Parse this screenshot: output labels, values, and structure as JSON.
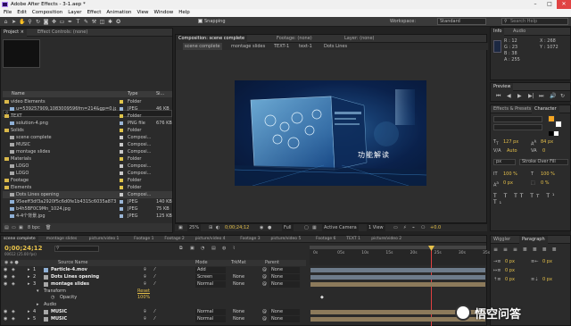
{
  "titlebar": {
    "title": "Adobe After Effects - 3-1.aep *",
    "min": "–",
    "max": "□",
    "close": "✕"
  },
  "menu": [
    "File",
    "Edit",
    "Composition",
    "Layer",
    "Effect",
    "Animation",
    "View",
    "Window",
    "Help"
  ],
  "toolbar": {
    "snapping": "Snapping",
    "workspace_label": "Workspace:",
    "workspace_value": "Standard",
    "search_placeholder": "Search Help"
  },
  "project": {
    "tabs": [
      "Project ×",
      "Effect Controls: (none)"
    ],
    "headers": {
      "name": "Name",
      "type": "Type",
      "size": "Si..."
    },
    "search_icon": "search-icon",
    "items": [
      {
        "name": "video Elements",
        "type": "Folder",
        "size": "",
        "color": "#e0c54a",
        "kind": "folder",
        "indent": 0
      },
      {
        "name": "u=539257909,1083009596fm=214&gp=0.jpg",
        "type": "JPEG",
        "size": "46 KB",
        "color": "#9bb6d6",
        "kind": "image",
        "indent": 1
      },
      {
        "name": "TEXT",
        "type": "Folder",
        "size": "",
        "color": "#e0c54a",
        "kind": "folder",
        "indent": 0
      },
      {
        "name": "solution-4.png",
        "type": "PNG file",
        "size": "676 KB",
        "color": "#9bb6d6",
        "kind": "image",
        "indent": 1
      },
      {
        "name": "Solids",
        "type": "Folder",
        "size": "",
        "color": "#e0c54a",
        "kind": "folder",
        "indent": 0
      },
      {
        "name": "scene complete",
        "type": "Composi...",
        "size": "",
        "color": "#c9c9c9",
        "kind": "comp",
        "indent": 1
      },
      {
        "name": "MUSIC",
        "type": "Composi...",
        "size": "",
        "color": "#c9c9c9",
        "kind": "comp",
        "indent": 1
      },
      {
        "name": "montage slides",
        "type": "Composi...",
        "size": "",
        "color": "#c9c9c9",
        "kind": "comp",
        "indent": 1
      },
      {
        "name": "Materials",
        "type": "Folder",
        "size": "",
        "color": "#e0c54a",
        "kind": "folder",
        "indent": 0
      },
      {
        "name": "LOGO",
        "type": "Composi...",
        "size": "",
        "color": "#c9c9c9",
        "kind": "comp",
        "indent": 1
      },
      {
        "name": "LOGO",
        "type": "Composi...",
        "size": "",
        "color": "#c9c9c9",
        "kind": "comp",
        "indent": 1
      },
      {
        "name": "Footage",
        "type": "Folder",
        "size": "",
        "color": "#e0c54a",
        "kind": "folder",
        "indent": 0
      },
      {
        "name": "Elements",
        "type": "Folder",
        "size": "",
        "color": "#e0c54a",
        "kind": "folder",
        "indent": 0
      },
      {
        "name": "Dots Lines opening",
        "type": "Composi...",
        "size": "",
        "color": "#c9c9c9",
        "kind": "comp",
        "indent": 1
      },
      {
        "name": "95eeff3df3a2920f5c6d0fe1b4315c6035a873df.jpg",
        "type": "JPEG",
        "size": "140 KB",
        "color": "#9bb6d6",
        "kind": "image",
        "indent": 1
      },
      {
        "name": "b4h5BF0C9Mn_1024.jpg",
        "type": "JPEG",
        "size": "75 KB",
        "color": "#9bb6d6",
        "kind": "image",
        "indent": 1
      },
      {
        "name": "4-4个背景.jpg",
        "type": "JPEG",
        "size": "125 KB",
        "color": "#9bb6d6",
        "kind": "image",
        "indent": 1
      }
    ],
    "footer": "8 bpc"
  },
  "viewer": {
    "tabs": [
      "Composition: scene complete",
      "Footage: (none)",
      "Layer: (none)"
    ],
    "breadcrumbs": [
      "scene complete",
      "montage slides",
      "TEXT-1",
      "text-1",
      "Dots Lines"
    ],
    "bottom": {
      "zoom": "25%",
      "time": "0;00;24;12",
      "quality": "Full",
      "camera": "Active Camera",
      "views": "1 View",
      "exposure": "+0.0"
    },
    "comp_text": "功能解读"
  },
  "timeline": {
    "tabs": [
      "scene complete",
      "montage slides",
      "picture/video 1",
      "Footage 1",
      "Footage 2",
      "picture/video 4",
      "Footage 3",
      "picture/video 5",
      "Footage 6",
      "TEXT 1",
      "picture/video 2"
    ],
    "current_time": "0;00;24;12",
    "fps": "00612 (25.00 fps)",
    "columns": {
      "source": "Source Name",
      "mode": "Mode",
      "trkmat": "TrkMat",
      "parent": "Parent"
    },
    "ruler": [
      "0s",
      "05s",
      "10s",
      "15s",
      "20s",
      "25s",
      "30s",
      "35s"
    ],
    "layers": [
      {
        "num": "1",
        "name": "Particle-4.mov",
        "mode": "Add",
        "trk": "",
        "parent": "None",
        "bar": "#6d7b8a",
        "kind": "footage"
      },
      {
        "num": "2",
        "name": "Dots Lines opening",
        "mode": "Screen",
        "trk": "None",
        "parent": "None",
        "bar": "#6d7b8a",
        "kind": "comp"
      },
      {
        "num": "3",
        "name": "montage slides",
        "mode": "Normal",
        "trk": "None",
        "parent": "None",
        "bar": "#8c7a5b",
        "kind": "comp"
      }
    ],
    "transform": {
      "label": "Transform",
      "reset": "Reset"
    },
    "opacity": {
      "label": "Opacity",
      "value": "100%"
    },
    "audio": {
      "label": "Audio"
    },
    "layers2": [
      {
        "num": "4",
        "name": "MUSIC",
        "mode": "Normal",
        "trk": "None",
        "parent": "None",
        "bar": "#8c7a5b",
        "kind": "comp"
      },
      {
        "num": "5",
        "name": "MUSIC",
        "mode": "Normal",
        "trk": "None",
        "parent": "None",
        "bar": "#8c7a5b",
        "kind": "comp"
      }
    ]
  },
  "info": {
    "tabs": [
      "Info",
      "Audio"
    ],
    "R": "R : 12",
    "G": "G : 23",
    "B": "B : 38",
    "A": "A : 255",
    "X": "X : 268",
    "Y": "Y : 1072"
  },
  "preview": {
    "tabs": [
      "Preview"
    ]
  },
  "character": {
    "tabs": [
      "Effects & Presets",
      "Character"
    ],
    "font_size": "127 px",
    "leading": "84 px",
    "tracking": "Auto",
    "kerning": "0",
    "px": "px",
    "stroke": "Stroke Over Fill",
    "scale_v": "100 %",
    "scale_h": "100 %",
    "baseline": "0 px",
    "tsume": "0 %"
  },
  "paragraph": {
    "tabs": [
      "Wiggler",
      "Paragraph"
    ],
    "indent1": "0 px",
    "indent2": "0 px",
    "indent3": "0 px",
    "space1": "0 px",
    "space2": "0 px"
  },
  "watermark": "悟空问答"
}
